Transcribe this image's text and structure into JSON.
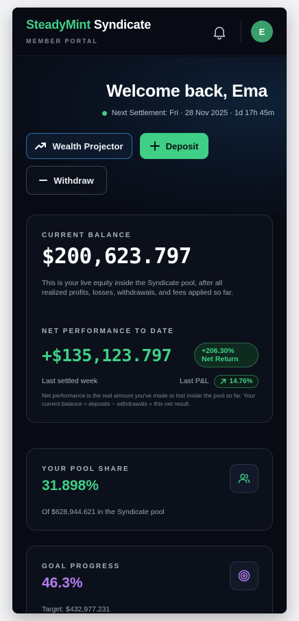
{
  "header": {
    "brand_primary": "SteadyMint",
    "brand_secondary": "Syndicate",
    "subtitle": "MEMBER PORTAL",
    "avatar_initial": "E",
    "bell_icon": "bell-icon"
  },
  "hero": {
    "welcome": "Welcome back, Ema",
    "settlement": "Next Settlement: Fri · 28 Nov 2025 · 1d 17h 45m"
  },
  "actions": {
    "projector_label": "Wealth Projector",
    "deposit_label": "Deposit",
    "withdraw_label": "Withdraw"
  },
  "balance_card": {
    "label": "CURRENT BALANCE",
    "value": "$200,623.797",
    "description": "This is your live equity inside the Syndicate pool, after all realized profits, losses, withdrawals, and fees applied so far.",
    "net_label": "NET PERFORMANCE TO DATE",
    "net_value": "+$135,123.797",
    "net_return_pct": "+206.30%",
    "net_return_label": "Net Return",
    "last_week_label": "Last settled week",
    "last_pnl_label": "Last P&L",
    "last_pnl_value": "14.76%",
    "footnote": "Net performance is the real amount you've made or lost inside the pool so far. Your current balance ≈ deposits − withdrawals + this net result."
  },
  "pool_card": {
    "label": "YOUR POOL SHARE",
    "value": "31.898%",
    "caption": "Of $628,944.621 in the Syndicate pool",
    "icon": "users-icon"
  },
  "goal_card": {
    "label": "GOAL PROGRESS",
    "value": "46.3%",
    "caption": "Target: $432,977.231",
    "icon": "target-icon"
  },
  "colors": {
    "accent_green": "#3fcf86",
    "accent_purple": "#b67cf0",
    "background": "#080b14"
  }
}
